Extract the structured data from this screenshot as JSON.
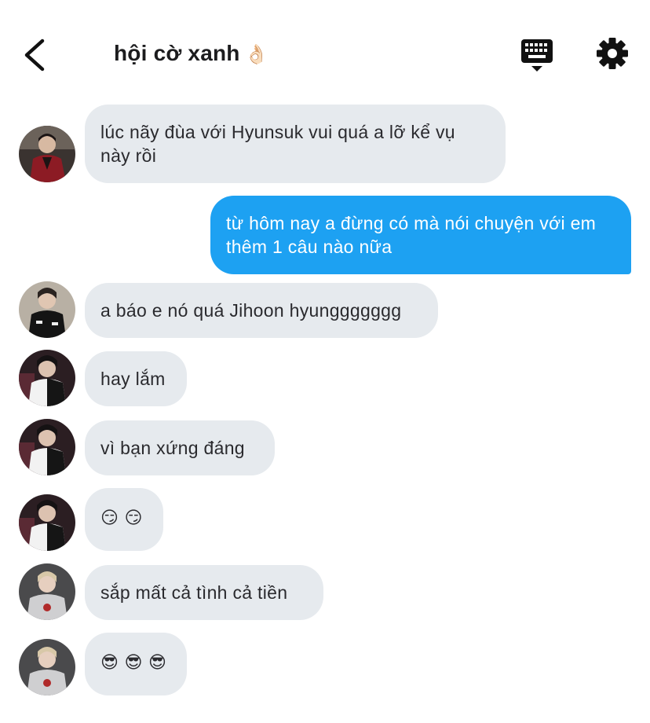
{
  "header": {
    "title": "hội cờ xanh",
    "title_emoji": "👌🏻",
    "back_icon": "chevron-left-icon",
    "keyboard_icon": "keyboard-icon",
    "settings_icon": "gear-icon"
  },
  "colors": {
    "incoming_bubble": "#e6eaee",
    "outgoing_bubble": "#1da1f2"
  },
  "messages": [
    {
      "direction": "incoming",
      "text": "lúc nãy đùa với Hyunsuk vui quá a lỡ kể vụ này rồi",
      "avatar": "avatar-red-jacket"
    },
    {
      "direction": "outgoing",
      "text": "từ hôm nay a đừng có mà nói chuyện với em thêm 1 câu nào nữa"
    },
    {
      "direction": "incoming",
      "text": "a báo e nó quá Jihoon hyunggggggg",
      "avatar": "avatar-black-jacket"
    },
    {
      "direction": "incoming",
      "text": "hay lắm",
      "avatar": "avatar-black-white-jacket"
    },
    {
      "direction": "incoming",
      "text": "vì bạn xứng đáng",
      "avatar": "avatar-black-white-jacket"
    },
    {
      "direction": "incoming",
      "text": "😏 😏",
      "avatar": "avatar-black-white-jacket"
    },
    {
      "direction": "incoming",
      "text": "sắp mất cả tình cả tiền",
      "avatar": "avatar-grey-hoodie"
    },
    {
      "direction": "incoming",
      "text": "😎 😎 😎",
      "avatar": "avatar-grey-hoodie"
    }
  ]
}
